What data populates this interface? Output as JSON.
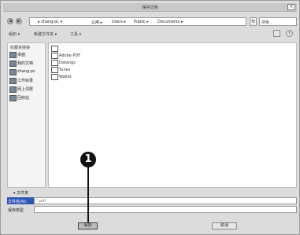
{
  "window": {
    "title": "保存文档",
    "close_glyph": "×"
  },
  "address_bar": {
    "back_glyph": "◀",
    "forward_glyph": "▶",
    "crumbs": [
      "▸ zhang-pc ▾",
      "公用 ▸",
      "Users ▸",
      "Public ▸",
      "Documents ▸"
    ],
    "refresh_glyph": "↻",
    "search_placeholder": "搜索..."
  },
  "toolbar": {
    "organize": "组织 ▾",
    "new_folder": "新建文件夹 ▾",
    "tools": "工具 ▾"
  },
  "sidebar": {
    "title": "收藏夹链接",
    "items": [
      {
        "label": "桌面",
        "icon": "desktop-icon"
      },
      {
        "label": "我的文档",
        "icon": "documents-icon"
      },
      {
        "label": "zhang-pc",
        "icon": "computer-icon"
      },
      {
        "label": "工作目录",
        "icon": "folder-icon"
      },
      {
        "label": "网上邻居",
        "icon": "network-icon"
      },
      {
        "label": "回收站",
        "icon": "recycle-bin-icon"
      }
    ]
  },
  "files": [
    {
      "name": ""
    },
    {
      "name": "Adobe PDF"
    },
    {
      "name": "Datangs"
    },
    {
      "name": "Tunes"
    },
    {
      "name": "Wallet"
    }
  ],
  "folder_toggle": "▾ 文件夹",
  "filename": {
    "label": "文件名(N):",
    "value": "*.pdf"
  },
  "filetype": {
    "label": "保存类型",
    "value": ""
  },
  "buttons": {
    "save": "保存",
    "cancel": "取消"
  },
  "callout_number": "1"
}
